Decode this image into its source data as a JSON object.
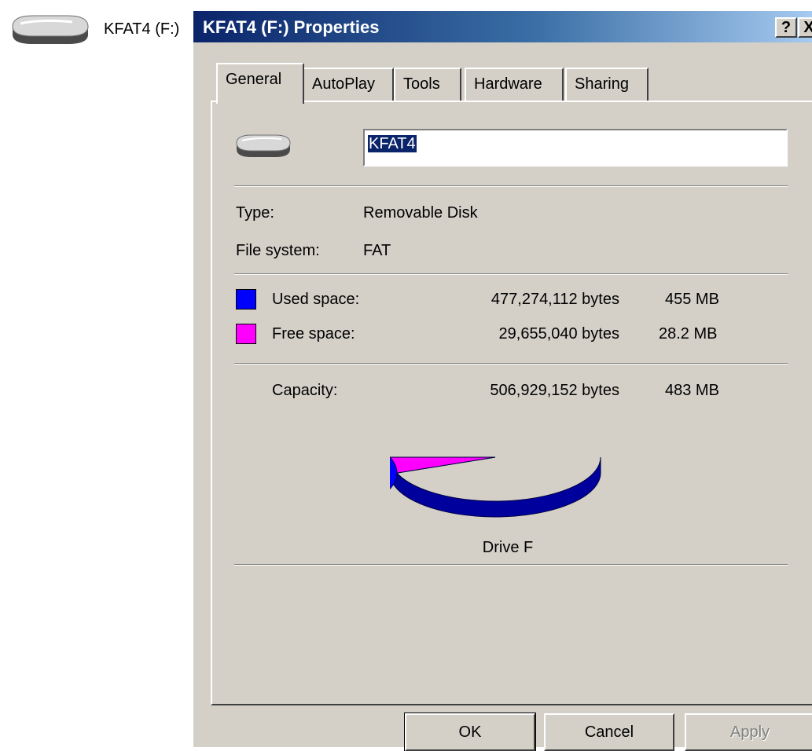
{
  "desktop": {
    "drive_label": "KFAT4 (F:)"
  },
  "window": {
    "title": "KFAT4 (F:) Properties",
    "help_button": "?",
    "close_button": "X"
  },
  "tabs": [
    {
      "label": "General",
      "active": true
    },
    {
      "label": "AutoPlay",
      "active": false
    },
    {
      "label": "Tools",
      "active": false
    },
    {
      "label": "Hardware",
      "active": false
    },
    {
      "label": "Sharing",
      "active": false
    }
  ],
  "general": {
    "volume_name": "KFAT4",
    "type_label": "Type:",
    "type_value": "Removable Disk",
    "fs_label": "File system:",
    "fs_value": "FAT",
    "used_label": "Used space:",
    "used_bytes": "477,274,112 bytes",
    "used_size": "455 MB",
    "free_label": "Free space:",
    "free_bytes": "29,655,040 bytes",
    "free_size": "28.2 MB",
    "capacity_label": "Capacity:",
    "capacity_bytes": "506,929,152 bytes",
    "capacity_size": "483 MB",
    "drive_caption": "Drive F"
  },
  "colors": {
    "used": "#0000ff",
    "free": "#ff00ff"
  },
  "usage": {
    "used_fraction": 0.9415,
    "free_fraction": 0.0585
  },
  "buttons": {
    "ok": "OK",
    "cancel": "Cancel",
    "apply": "Apply"
  }
}
